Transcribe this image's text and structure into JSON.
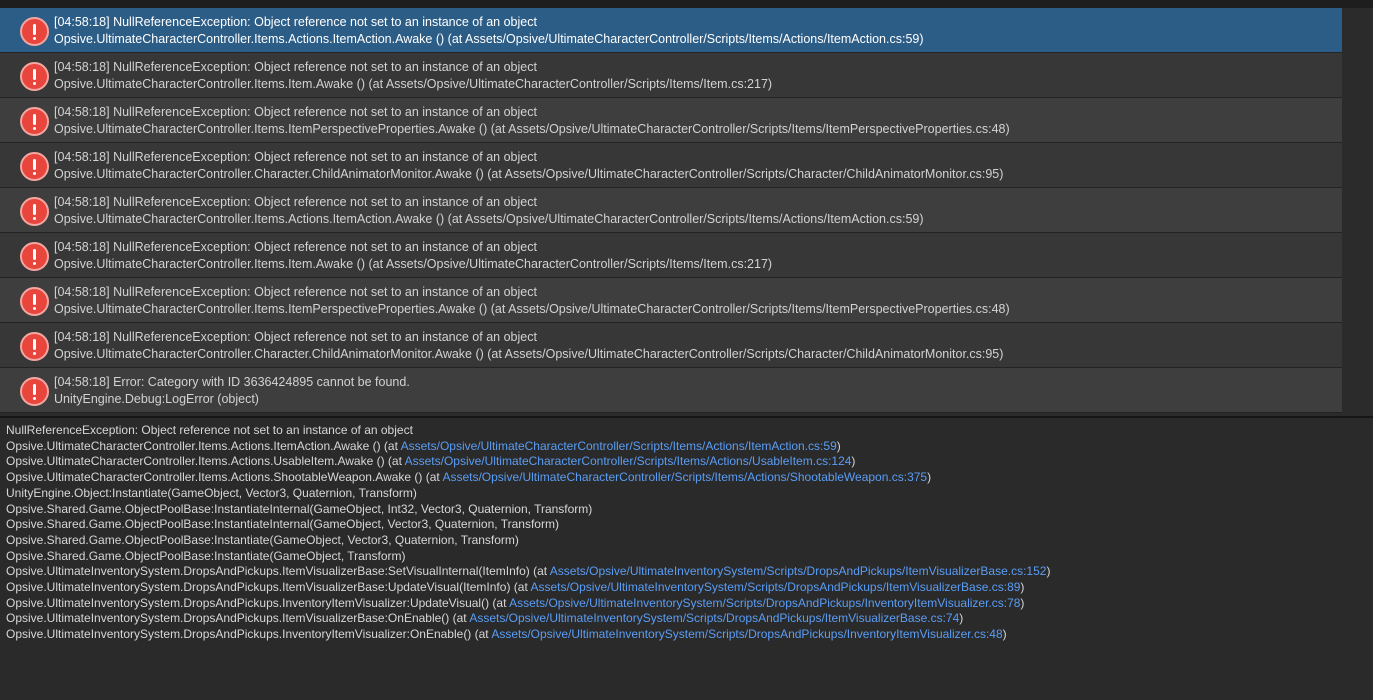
{
  "colors": {
    "selected_row": "#2c5d87",
    "error_icon": "#e8453c",
    "link": "#5a9df5"
  },
  "log_entries": [
    {
      "line1": "[04:58:18] NullReferenceException: Object reference not set to an instance of an object",
      "line2": "Opsive.UltimateCharacterController.Items.Actions.ItemAction.Awake () (at Assets/Opsive/UltimateCharacterController/Scripts/Items/Actions/ItemAction.cs:59)",
      "icon": "error-icon",
      "selected": true
    },
    {
      "line1": "[04:58:18] NullReferenceException: Object reference not set to an instance of an object",
      "line2": "Opsive.UltimateCharacterController.Items.Item.Awake () (at Assets/Opsive/UltimateCharacterController/Scripts/Items/Item.cs:217)",
      "icon": "error-icon"
    },
    {
      "line1": "[04:58:18] NullReferenceException: Object reference not set to an instance of an object",
      "line2": "Opsive.UltimateCharacterController.Items.ItemPerspectiveProperties.Awake () (at Assets/Opsive/UltimateCharacterController/Scripts/Items/ItemPerspectiveProperties.cs:48)",
      "icon": "error-icon"
    },
    {
      "line1": "[04:58:18] NullReferenceException: Object reference not set to an instance of an object",
      "line2": "Opsive.UltimateCharacterController.Character.ChildAnimatorMonitor.Awake () (at Assets/Opsive/UltimateCharacterController/Scripts/Character/ChildAnimatorMonitor.cs:95)",
      "icon": "error-icon"
    },
    {
      "line1": "[04:58:18] NullReferenceException: Object reference not set to an instance of an object",
      "line2": "Opsive.UltimateCharacterController.Items.Actions.ItemAction.Awake () (at Assets/Opsive/UltimateCharacterController/Scripts/Items/Actions/ItemAction.cs:59)",
      "icon": "error-icon"
    },
    {
      "line1": "[04:58:18] NullReferenceException: Object reference not set to an instance of an object",
      "line2": "Opsive.UltimateCharacterController.Items.Item.Awake () (at Assets/Opsive/UltimateCharacterController/Scripts/Items/Item.cs:217)",
      "icon": "error-icon"
    },
    {
      "line1": "[04:58:18] NullReferenceException: Object reference not set to an instance of an object",
      "line2": "Opsive.UltimateCharacterController.Items.ItemPerspectiveProperties.Awake () (at Assets/Opsive/UltimateCharacterController/Scripts/Items/ItemPerspectiveProperties.cs:48)",
      "icon": "error-icon"
    },
    {
      "line1": "[04:58:18] NullReferenceException: Object reference not set to an instance of an object",
      "line2": "Opsive.UltimateCharacterController.Character.ChildAnimatorMonitor.Awake () (at Assets/Opsive/UltimateCharacterController/Scripts/Character/ChildAnimatorMonitor.cs:95)",
      "icon": "error-icon"
    },
    {
      "line1": "[04:58:18] Error: Category with ID 3636424895 cannot be found.",
      "line2": "UnityEngine.Debug:LogError (object)",
      "icon": "error-icon"
    }
  ],
  "detail": {
    "lines": [
      {
        "text": "NullReferenceException: Object reference not set to an instance of an object",
        "link": ""
      },
      {
        "text": "Opsive.UltimateCharacterController.Items.Actions.ItemAction.Awake () (at ",
        "link": "Assets/Opsive/UltimateCharacterController/Scripts/Items/Actions/ItemAction.cs:59",
        "tail": ")"
      },
      {
        "text": "Opsive.UltimateCharacterController.Items.Actions.UsableItem.Awake () (at ",
        "link": "Assets/Opsive/UltimateCharacterController/Scripts/Items/Actions/UsableItem.cs:124",
        "tail": ")"
      },
      {
        "text": "Opsive.UltimateCharacterController.Items.Actions.ShootableWeapon.Awake () (at ",
        "link": "Assets/Opsive/UltimateCharacterController/Scripts/Items/Actions/ShootableWeapon.cs:375",
        "tail": ")"
      },
      {
        "text": "UnityEngine.Object:Instantiate(GameObject, Vector3, Quaternion, Transform)",
        "link": ""
      },
      {
        "text": "Opsive.Shared.Game.ObjectPoolBase:InstantiateInternal(GameObject, Int32, Vector3, Quaternion, Transform)",
        "link": ""
      },
      {
        "text": "Opsive.Shared.Game.ObjectPoolBase:InstantiateInternal(GameObject, Vector3, Quaternion, Transform)",
        "link": ""
      },
      {
        "text": "Opsive.Shared.Game.ObjectPoolBase:Instantiate(GameObject, Vector3, Quaternion, Transform)",
        "link": ""
      },
      {
        "text": "Opsive.Shared.Game.ObjectPoolBase:Instantiate(GameObject, Transform)",
        "link": ""
      },
      {
        "text": "Opsive.UltimateInventorySystem.DropsAndPickups.ItemVisualizerBase:SetVisualInternal(ItemInfo) (at ",
        "link": "Assets/Opsive/UltimateInventorySystem/Scripts/DropsAndPickups/ItemVisualizerBase.cs:152",
        "tail": ")"
      },
      {
        "text": "Opsive.UltimateInventorySystem.DropsAndPickups.ItemVisualizerBase:UpdateVisual(ItemInfo) (at ",
        "link": "Assets/Opsive/UltimateInventorySystem/Scripts/DropsAndPickups/ItemVisualizerBase.cs:89",
        "tail": ")"
      },
      {
        "text": "Opsive.UltimateInventorySystem.DropsAndPickups.InventoryItemVisualizer:UpdateVisual() (at ",
        "link": "Assets/Opsive/UltimateInventorySystem/Scripts/DropsAndPickups/InventoryItemVisualizer.cs:78",
        "tail": ")"
      },
      {
        "text": "Opsive.UltimateInventorySystem.DropsAndPickups.ItemVisualizerBase:OnEnable() (at ",
        "link": "Assets/Opsive/UltimateInventorySystem/Scripts/DropsAndPickups/ItemVisualizerBase.cs:74",
        "tail": ")"
      },
      {
        "text": "Opsive.UltimateInventorySystem.DropsAndPickups.InventoryItemVisualizer:OnEnable() (at ",
        "link": "Assets/Opsive/UltimateInventorySystem/Scripts/DropsAndPickups/InventoryItemVisualizer.cs:48",
        "tail": ")"
      }
    ]
  }
}
